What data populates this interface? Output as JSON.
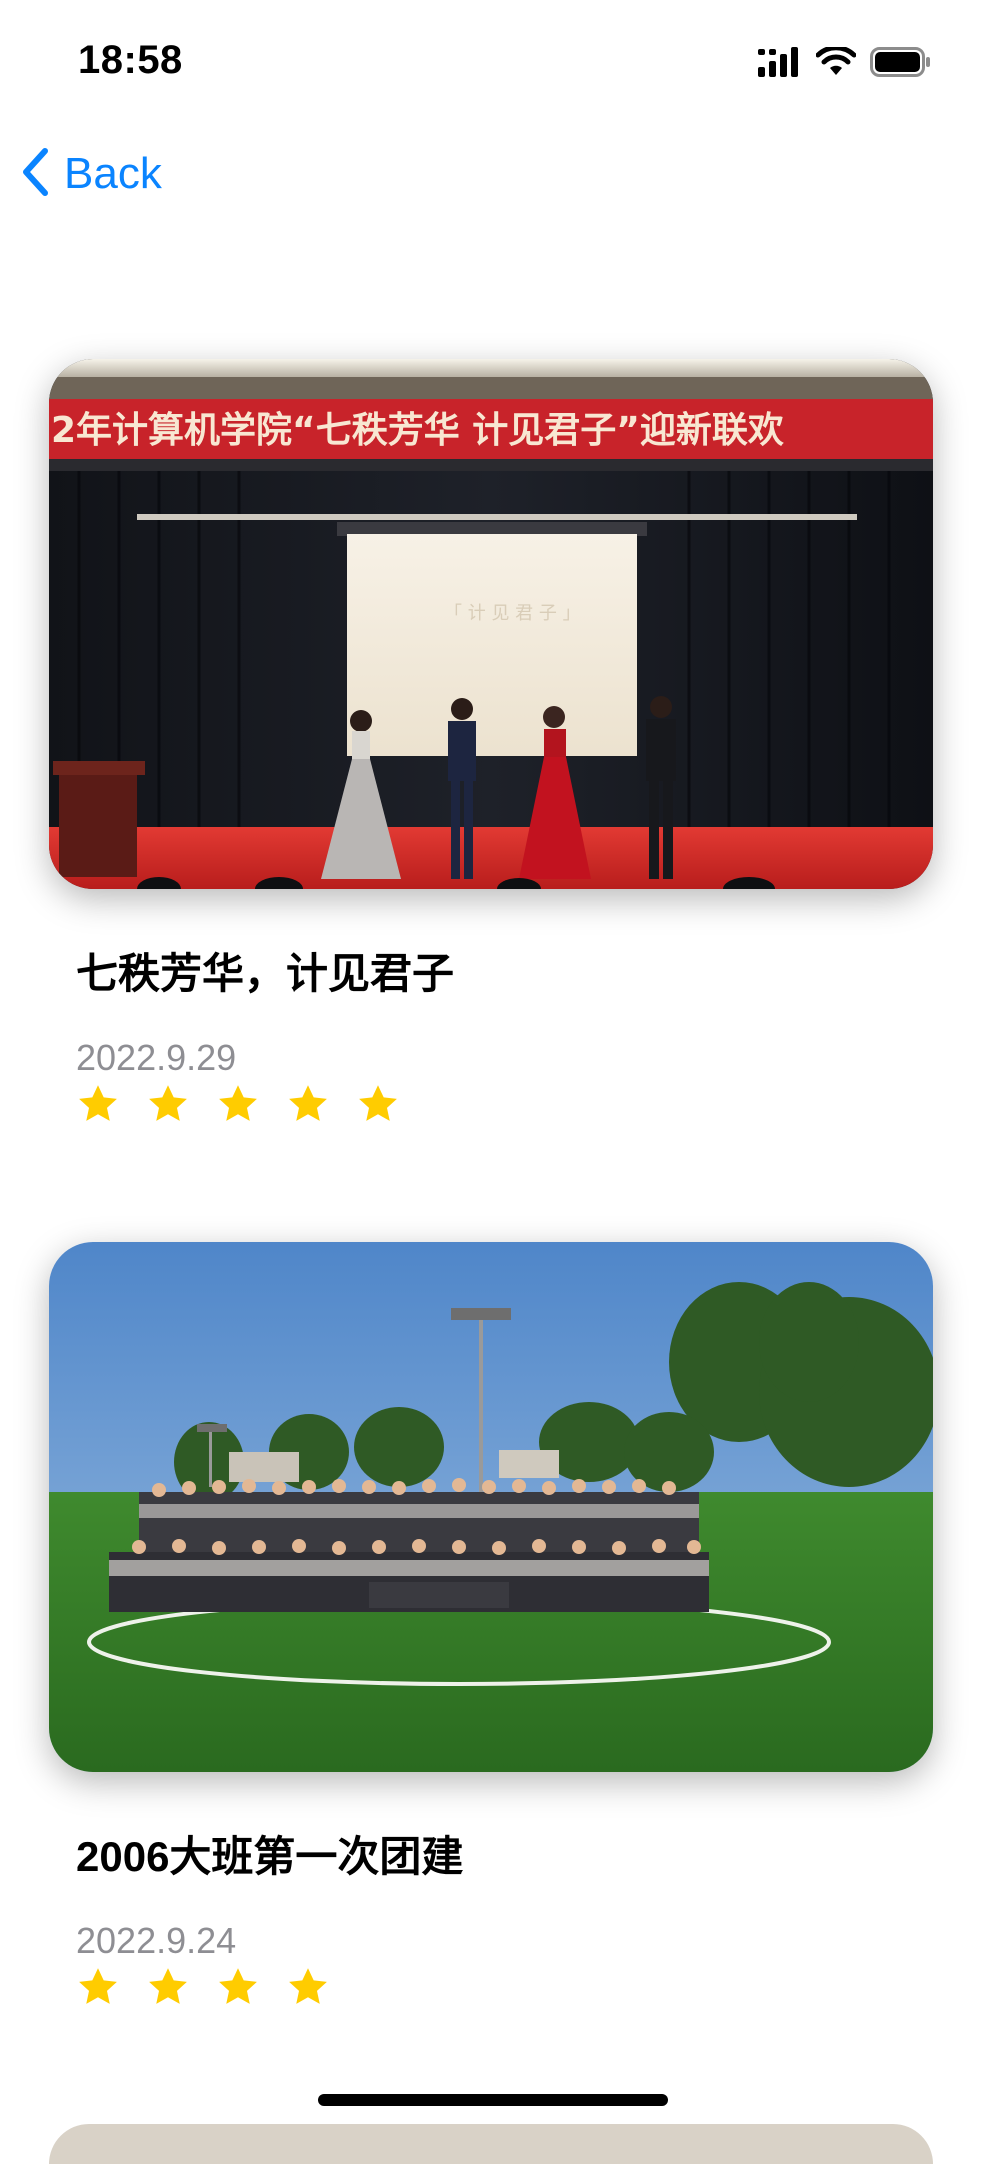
{
  "status_bar": {
    "time": "18:58",
    "icons": [
      "cellular-signal-icon",
      "wifi-icon",
      "battery-icon"
    ]
  },
  "nav": {
    "back_label": "Back",
    "back_icon": "chevron-left-icon",
    "accent_color": "#0a84ff"
  },
  "events": [
    {
      "photo": "stage-event-photo",
      "photo_banner": "2年计算机学院“七秩芳华 计见君子”迎新联欢",
      "title": "七秩芳华，计见君子",
      "date": "2022.9.29",
      "rating": 5
    },
    {
      "photo": "group-photo-football-field",
      "title": "2006大班第一次团建",
      "date": "2022.9.24",
      "rating": 4
    }
  ],
  "colors": {
    "star": "#ffcc00",
    "date_text": "#8e8e93"
  }
}
